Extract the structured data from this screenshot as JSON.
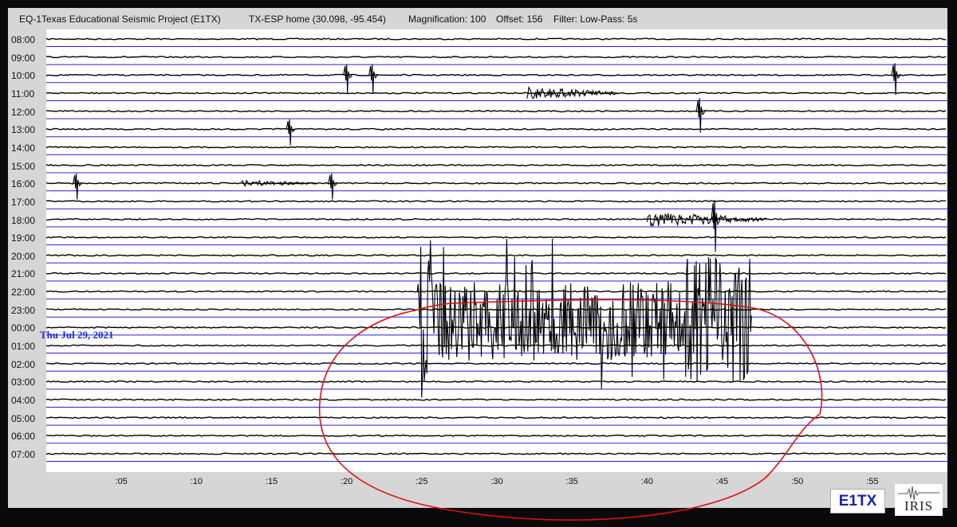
{
  "header": {
    "title": "EQ-1Texas Educational Seismic Project (E1TX)",
    "station": "TX-ESP home (30.098, -95.454)",
    "magnification": "Magnification: 100",
    "offset": "Offset: 156",
    "filter": "Filter: Low-Pass: 5s"
  },
  "date_label": "Thu Jul 29, 2021",
  "logos": {
    "e1tx": "E1TX",
    "iris": "IRIS"
  },
  "colors": {
    "grid_line": "#2222dd",
    "trace": "#000000",
    "annotation": "#e01010",
    "date_text": "#1f2ed0"
  },
  "chart_data": {
    "type": "line",
    "row_labels": [
      "08:00",
      "09:00",
      "10:00",
      "11:00",
      "12:00",
      "13:00",
      "14:00",
      "15:00",
      "16:00",
      "17:00",
      "18:00",
      "19:00",
      "20:00",
      "21:00",
      "22:00",
      "23:00",
      "00:00",
      "01:00",
      "02:00",
      "03:00",
      "04:00",
      "05:00",
      "06:00",
      "07:00"
    ],
    "x_tick_labels": [
      ":05",
      ":10",
      ":15",
      ":20",
      ":25",
      ":30",
      ":35",
      ":40",
      ":45",
      ":50",
      ":55"
    ],
    "x_tick_minutes": [
      5,
      10,
      15,
      20,
      25,
      30,
      35,
      40,
      45,
      50,
      55
    ],
    "xlim": [
      0,
      60
    ],
    "grid": true,
    "events": [
      {
        "row": 2,
        "minute": 20,
        "type": "spike",
        "amp": 1.0
      },
      {
        "row": 2,
        "minute": 21.7,
        "type": "spike",
        "amp": 1.0
      },
      {
        "row": 2,
        "minute": 56.5,
        "type": "spike",
        "amp": 1.1
      },
      {
        "row": 3,
        "minute": 32,
        "type": "burst",
        "amp": 0.35,
        "duration": 6
      },
      {
        "row": 4,
        "minute": 43.5,
        "type": "spike",
        "amp": 1.2
      },
      {
        "row": 5,
        "minute": 16.2,
        "type": "spike",
        "amp": 0.9
      },
      {
        "row": 8,
        "minute": 2,
        "type": "spike",
        "amp": 0.9
      },
      {
        "row": 8,
        "minute": 13,
        "type": "burst",
        "amp": 0.18,
        "duration": 5
      },
      {
        "row": 8,
        "minute": 19,
        "type": "spike",
        "amp": 0.9
      },
      {
        "row": 10,
        "minute": 40,
        "type": "burst",
        "amp": 0.4,
        "duration": 8
      },
      {
        "row": 10,
        "minute": 44.5,
        "type": "spike",
        "amp": 1.8
      },
      {
        "row": 11,
        "minute": 24.7,
        "type": "quake",
        "amp": 4.0,
        "end": 47
      }
    ]
  }
}
